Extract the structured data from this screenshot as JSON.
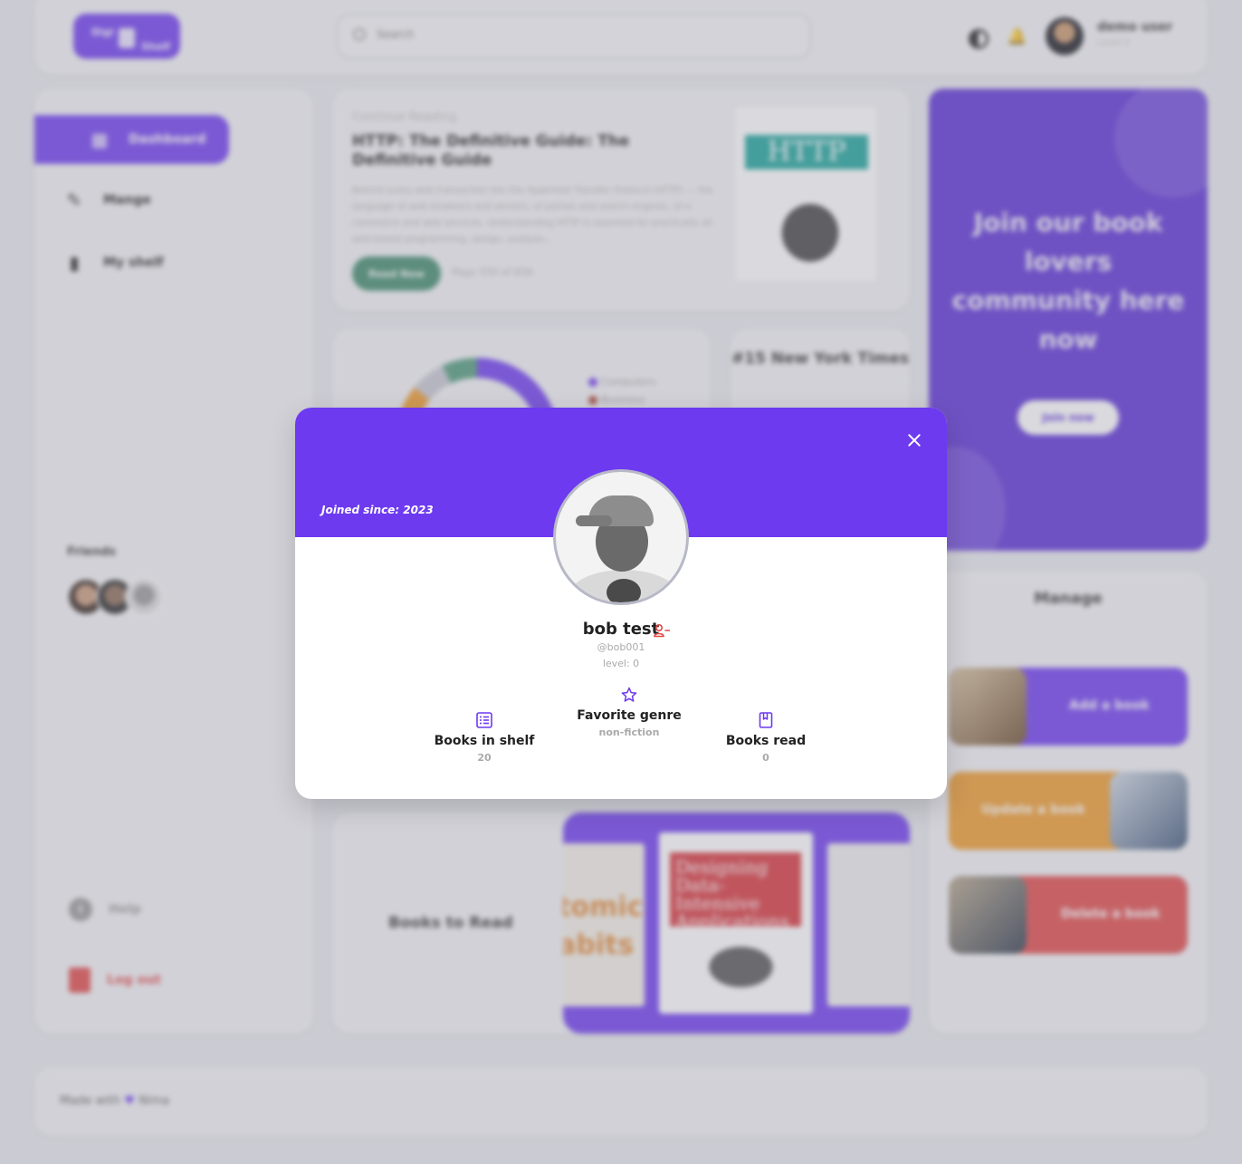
{
  "header": {
    "logo": {
      "line1": "Digi",
      "line2": "Shelf"
    },
    "search_placeholder": "Search",
    "user": {
      "name": "demo user",
      "level": "Level 2"
    }
  },
  "sidebar": {
    "items": [
      {
        "label": "Dashboard",
        "icon": "dashboard-icon"
      },
      {
        "label": "Mange",
        "icon": "edit-icon"
      },
      {
        "label": "My shelf",
        "icon": "book-icon"
      }
    ],
    "friends_label": "Friends",
    "help_label": "Help",
    "logout_label": "Log out"
  },
  "continue_reading": {
    "eyebrow": "Continue Reading",
    "title": "HTTP: The Definitive Guide: The Definitive Guide",
    "description": "Behind every web transaction lies the Hypertext Transfer Protocol (HTTP) — the language of web browsers and servers, of portals and search engines, of e-commerce and web services. Understanding HTTP is essential for practically all web-based programming, design, analysis...",
    "button": "Read Now",
    "page": "Page 550 of 656",
    "cover_title": "HTTP"
  },
  "genre_chart": {
    "legend": [
      {
        "label": "Computers",
        "color": "#6d3af0"
      },
      {
        "label": "Business",
        "color": "#a83a2a"
      }
    ]
  },
  "nyt": {
    "title": "#15 New York Times"
  },
  "books_to_read": {
    "label": "Books to Read",
    "cover_left": "tomic abits",
    "cover_center": "Designing Data-Intensive Applications"
  },
  "join": {
    "text": "Join our book lovers community here now",
    "button": "Join now"
  },
  "manage": {
    "title": "Manage",
    "add": "Add a book",
    "update": "Update a book",
    "delete": "Delete a book"
  },
  "footer": {
    "made_with": "Made with",
    "author": "Nima"
  },
  "modal": {
    "joined": "Joined since: 2023",
    "name": "bob test",
    "handle": "@bob001",
    "level": "level: 0",
    "stats": {
      "shelf": {
        "label": "Books in shelf",
        "value": "20"
      },
      "genre": {
        "label": "Favorite genre",
        "value": "non-fiction"
      },
      "read": {
        "label": "Books read",
        "value": "0"
      }
    }
  },
  "colors": {
    "accent": "#6d3af0",
    "danger": "#e04848",
    "warning": "#ee9a2a",
    "success": "#3f8a6a"
  }
}
